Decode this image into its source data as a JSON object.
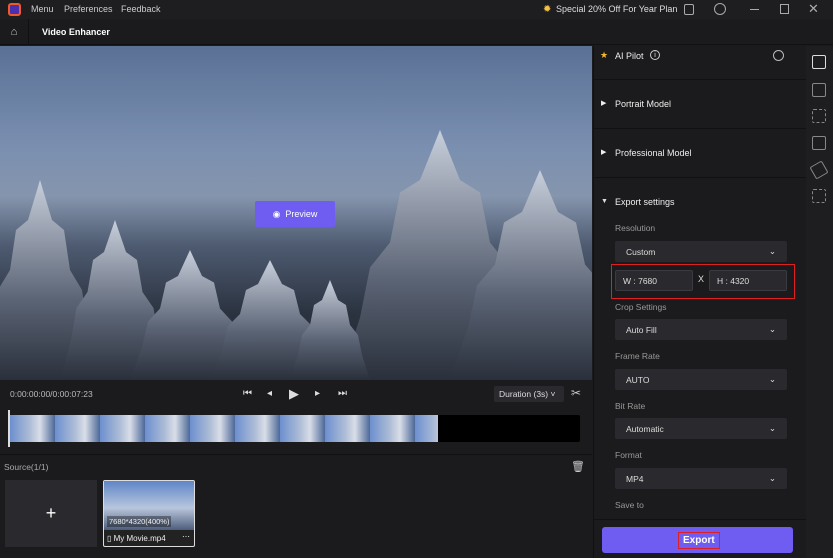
{
  "titlebar": {
    "menu": "Menu",
    "preferences": "Preferences",
    "feedback": "Feedback",
    "promo": "Special 20% Off For Year Plan"
  },
  "header": {
    "title": "Video Enhancer"
  },
  "preview": {
    "label": "Preview"
  },
  "player": {
    "time": "0:00:00:00/0:00:07:23",
    "duration": "Duration (3s)"
  },
  "source": {
    "label": "Source(1/1)",
    "file": {
      "name": "My Movie.mp4",
      "resolution": "7680*4320(400%)"
    }
  },
  "panel": {
    "ai_pilot": "AI Pilot",
    "portrait": "Portrait Model",
    "professional": "Professional Model",
    "export_settings": "Export settings",
    "resolution_label": "Resolution",
    "resolution": "Custom",
    "width": "W : 7680",
    "x": "X",
    "height": "H : 4320",
    "crop_label": "Crop Settings",
    "crop": "Auto Fill",
    "framerate_label": "Frame Rate",
    "framerate": "AUTO",
    "bitrate_label": "Bit Rate",
    "bitrate": "Automatic",
    "format_label": "Format",
    "format": "MP4",
    "saveto_label": "Save to",
    "export": "Export"
  },
  "colors": {
    "accent": "#6f5cf0",
    "highlight": "#e02020"
  }
}
